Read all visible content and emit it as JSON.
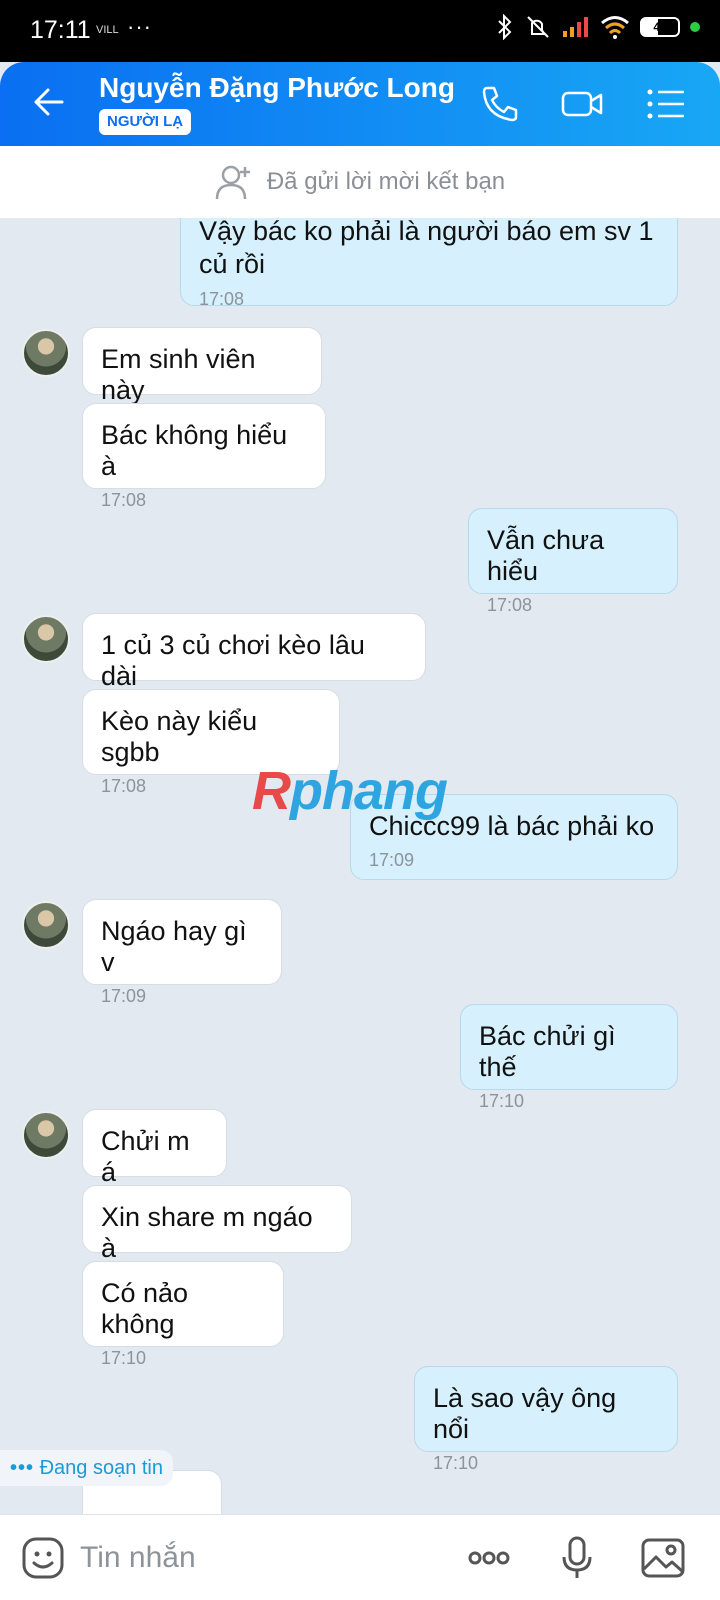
{
  "status_bar": {
    "time": "17:11",
    "carrier": "VILL",
    "dots": "···",
    "battery": "49"
  },
  "header": {
    "contact_name": "Nguyễn Đặng Phước Long",
    "badge": "NGƯỜI LẠ"
  },
  "friend_bar": {
    "text": "Đã gửi lời mời kết bạn"
  },
  "messages": [
    {
      "side": "out",
      "text_line1": "Vậy bác ko phải là người báo em sv 1",
      "text_line2": "củ rồi",
      "time": "17:08"
    },
    {
      "side": "in",
      "text": "Em sinh viên này"
    },
    {
      "side": "in",
      "text": "Bác không hiểu à",
      "time": "17:08"
    },
    {
      "side": "out",
      "text": "Vẫn chưa hiểu",
      "time": "17:08"
    },
    {
      "side": "in",
      "text": "1 củ 3 củ chơi kèo lâu dài"
    },
    {
      "side": "in",
      "text": "Kèo này kiểu sgbb",
      "time": "17:08"
    },
    {
      "side": "out",
      "text": "Chiccc99 là bác phải ko",
      "time": "17:09"
    },
    {
      "side": "in",
      "text": "Ngáo hay gì v",
      "time": "17:09"
    },
    {
      "side": "out",
      "text": "Bác chửi gì thế",
      "time": "17:10"
    },
    {
      "side": "in",
      "text": "Chửi m á"
    },
    {
      "side": "in",
      "text": "Xin share m ngáo à"
    },
    {
      "side": "in",
      "text": "Có nảo không",
      "time": "17:10"
    },
    {
      "side": "out",
      "text": "Là sao vậy ông nổi",
      "time": "17:10"
    }
  ],
  "typing_indicator": "Đang soạn tin",
  "watermark": {
    "part1": "R",
    "part2": "phang"
  },
  "input": {
    "placeholder": "Tin nhắn"
  },
  "colors": {
    "header_start": "#0a6ff2",
    "header_end": "#18a7f5",
    "outgoing_bubble": "#d6f0fd",
    "chat_bg": "#e2e9f1"
  }
}
